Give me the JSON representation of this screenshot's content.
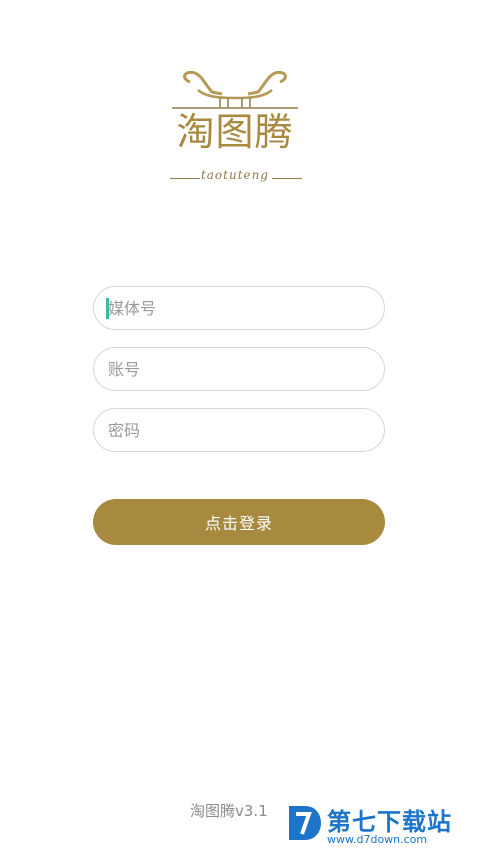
{
  "logo": {
    "title": "淘图腾",
    "subtitle": "taotuteng"
  },
  "form": {
    "media_placeholder": "媒体号",
    "account_placeholder": "账号",
    "password_placeholder": "密码",
    "login_label": "点击登录"
  },
  "footer": {
    "version": "淘图腾v3.1"
  },
  "watermark": {
    "name": "第七下载站",
    "url": "www.d7down.com"
  },
  "colors": {
    "brand_gold": "#a7893f",
    "caret": "#3bb6a7",
    "watermark_blue": "#1d74c9"
  }
}
